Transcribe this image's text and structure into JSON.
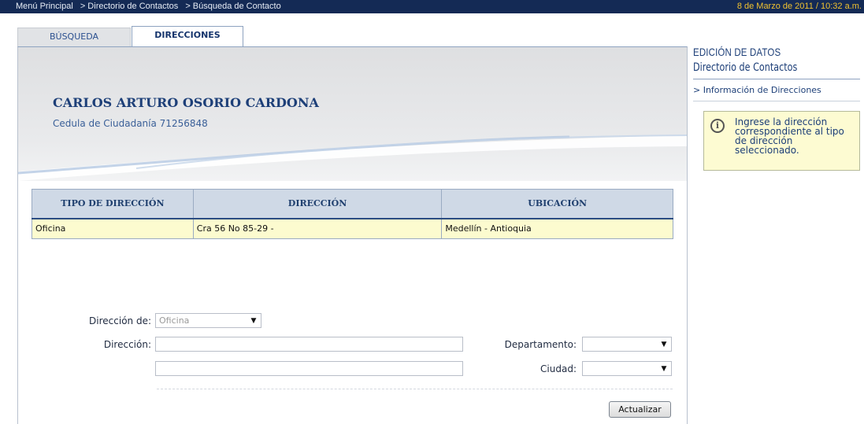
{
  "topbar": {
    "breadcrumbs": [
      "Menú Principal",
      "> Directorio de Contactos",
      "> Búsqueda de Contacto"
    ],
    "datetime": "8 de Marzo de 2011 / 10:32 a.m."
  },
  "tabs": [
    {
      "label": "BÚSQUEDA",
      "active": false
    },
    {
      "label": "DIRECCIONES",
      "active": true
    }
  ],
  "contact": {
    "name": "CARLOS ARTURO OSORIO CARDONA",
    "id_text": "Cedula de Ciudadanía 71256848"
  },
  "table": {
    "columns": [
      "TIPO DE DIRECCIÓN",
      "DIRECCIÓN",
      "UBICACIÓN"
    ],
    "rows": [
      [
        "Oficina",
        "Cra 56 No 85-29 -",
        "Medellín - Antioquia"
      ]
    ]
  },
  "form": {
    "direccion_de_label": "Dirección de:",
    "direccion_de_value": "Oficina",
    "direccion_label": "Dirección:",
    "direccion_line1": "",
    "direccion_line2": "",
    "departamento_label": "Departamento:",
    "departamento_value": "",
    "ciudad_label": "Ciudad:",
    "ciudad_value": "",
    "submit_label": "Actualizar"
  },
  "sidebar": {
    "title": "EDICIÓN DE DATOS",
    "subtitle": "Directorio de Contactos",
    "link": "> Información de Direcciones",
    "info_message": "Ingrese la dirección correspondiente al tipo de dirección seleccionado."
  },
  "colors": {
    "topbar": "#142a55",
    "date": "#f0c230",
    "accent": "#1d3f78",
    "row_highlight": "#fcfbcf",
    "info_bg": "#fdfbd2"
  }
}
